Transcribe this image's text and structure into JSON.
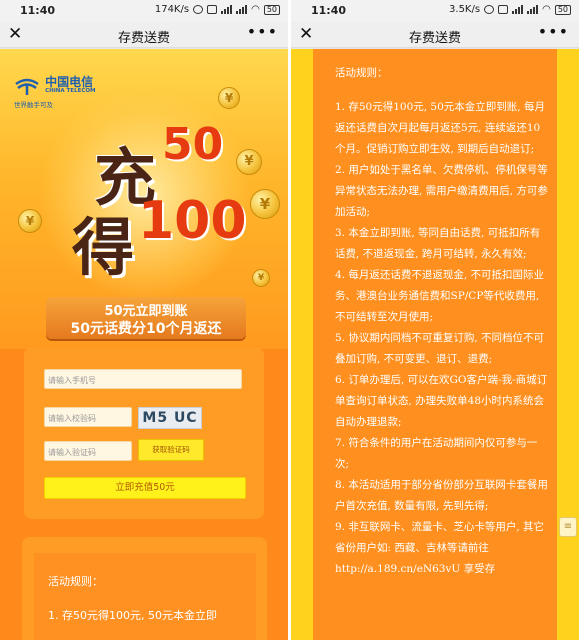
{
  "left": {
    "status": {
      "time": "11:40",
      "speed": "174K/s",
      "battery": "50"
    },
    "nav": {
      "close": "✕",
      "title": "存费送费",
      "more": "•••"
    },
    "logo": {
      "cn": "中国电信",
      "en": "CHINA TELECOM",
      "tagline": "世界触手可及"
    },
    "hero": {
      "chong": "充",
      "fifty": "50",
      "de": "得",
      "hundred": "100",
      "coin": "¥",
      "ribbon_line1": "50元立即到账",
      "ribbon_line2": "50元话费分10个月返还"
    },
    "form": {
      "phone_placeholder": "请输入手机号",
      "check_placeholder": "请输入校验码",
      "captcha_text": "M5 UC",
      "sms_placeholder": "请输入验证码",
      "get_code_label": "获取验证码",
      "submit_label": "立即充值50元"
    },
    "rules_preview": {
      "heading": "活动规则：",
      "line1": "1. 存50元得100元, 50元本金立即"
    }
  },
  "right": {
    "status": {
      "time": "11:40",
      "speed": "3.5K/s",
      "battery": "50"
    },
    "nav": {
      "close": "✕",
      "title": "存费送费",
      "more": "•••"
    },
    "rules": {
      "heading": "活动规则：",
      "items": [
        "1. 存50元得100元, 50元本金立即到账, 每月返还话费自次月起每月返还5元, 连续返还10个月。促销订购立即生效, 到期后自动退订;",
        "2. 用户如处于黑名单、欠费停机、停机保号等异常状态无法办理, 需用户缴清费用后, 方可参加活动;",
        "3. 本金立即到账, 等同自由话费, 可抵扣所有话费, 不退返现金, 跨月可结转, 永久有效;",
        "4. 每月返还话费不退返现金, 不可抵扣国际业务、港澳台业务通信费和SP/CP等代收费用, 不可结转至次月使用;",
        "5. 协议期内同档不可重复订购, 不同档位不可叠加订购, 不可变更、退订、退费;",
        "6. 订单办理后, 可以在欢GO客户端-我-商城订单查询订单状态, 办理失败单48小时内系统会自动办理退款;",
        "7. 符合条件的用户在活动期间内仅可参与一次;",
        "8. 本活动适用于部分省份部分互联网卡套餐用户首次充值, 数量有限, 先到先得;",
        "9. 非互联网卡、流量卡、芝心卡等用户, 其它省份用户如: 西藏、吉林等请前往",
        "http://a.189.cn/eN63vU 享受存"
      ]
    },
    "scroll_handle": "≡"
  }
}
